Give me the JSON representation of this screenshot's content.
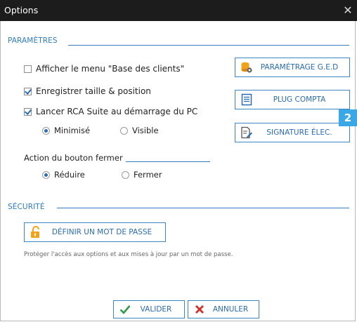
{
  "window": {
    "title": "Options",
    "close_glyph": "✕"
  },
  "badge": {
    "text": "2"
  },
  "colors": {
    "accent": "#2f7cc1",
    "badge": "#39a8e4",
    "cancel_red": "#d0312d",
    "ok_green": "#2e9a49"
  },
  "parametres": {
    "title": "PARAMÈTRES",
    "menu_clients": {
      "label": "Afficher le menu \"Base des clients\"",
      "checked": false
    },
    "save_size": {
      "label": "Enregistrer taille & position",
      "checked": true
    },
    "launch_startup": {
      "label": "Lancer RCA Suite au démarrage du PC",
      "checked": true
    },
    "launch_mode": {
      "options": [
        "Minimisé",
        "Visible"
      ],
      "selected": "Minimisé"
    },
    "close_action": {
      "title": "Action du bouton fermer",
      "options": [
        "Réduire",
        "Fermer"
      ],
      "selected": "Réduire"
    }
  },
  "side_buttons": [
    {
      "label": "PARAMÉTRAGE G.E.D",
      "icon": "database-gear-icon"
    },
    {
      "label": "PLUG COMPTA",
      "icon": "ledger-icon"
    },
    {
      "label": "SIGNATURE ÉLEC.",
      "icon": "document-pen-icon"
    }
  ],
  "securite": {
    "title": "SÉCURITÉ",
    "password_button": {
      "label": "DÉFINIR UN MOT DE PASSE",
      "icon": "padlock-icon"
    },
    "hint": "Protéger l'accès aux options et aux mises à jour par un mot de passe."
  },
  "footer": {
    "ok": {
      "label": "VALIDER",
      "icon": "checkmark-icon"
    },
    "cancel": {
      "label": "ANNULER",
      "icon": "x-mark-icon"
    }
  }
}
